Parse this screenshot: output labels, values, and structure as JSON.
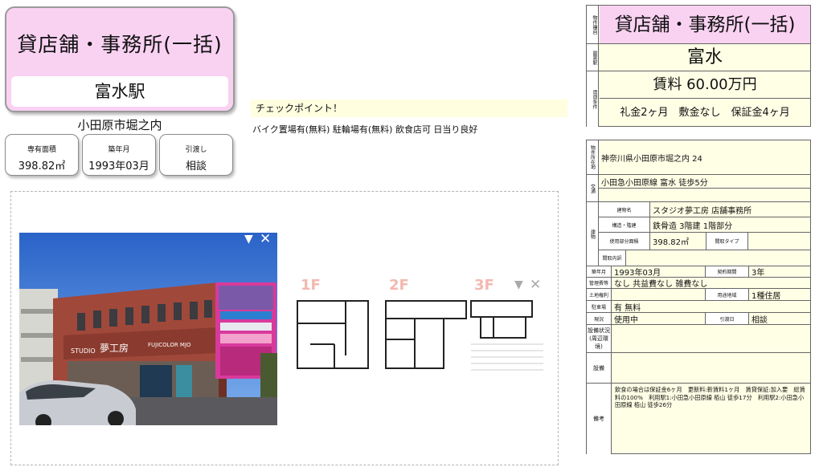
{
  "title_card": {
    "property_type": "貸店舗・事務所(一括)",
    "station": "富水駅"
  },
  "address_short": "小田原市堀之内",
  "stats": [
    {
      "label": "専有面積",
      "value": "398.82㎡"
    },
    {
      "label": "築年月",
      "value": "1993年03月"
    },
    {
      "label": "引渡し",
      "value": "相談"
    }
  ],
  "check_point": {
    "title": "チェックポイント！",
    "text": "バイク置場有(無料) 駐輪場有(無料) 飲食店可 日当り良好"
  },
  "photo": {
    "sign_main": "夢工房",
    "sign_studio": "STUDIO",
    "sign_film": "FUJICOLOR MJO"
  },
  "floorplan": {
    "floors": [
      "1F",
      "2F",
      "3F"
    ]
  },
  "summary": {
    "type_label": "物件種目",
    "type": "貸店舗・事務所(一括)",
    "station_label": "最寄駅",
    "station": "富水",
    "rent_label": "賃貸条件",
    "rent": "賃料 60.00万円",
    "conditions": "礼金2ヶ月　敷金なし　保証金4ヶ月"
  },
  "detail": {
    "address_label": "物件所在地",
    "address": "神奈川県小田原市堀之内 24",
    "traffic_label": "交通",
    "traffic": "小田急小田原線 富水 徒歩5分",
    "building_label": "建物",
    "building_name_label": "建物名",
    "building_name": "スタジオ夢工房 店舗事務所",
    "structure_label": "構造・階建",
    "structure": "鉄骨造 3階建 1階部分",
    "area_label": "使用部分面積",
    "area": "398.82㎡",
    "layout_type_label": "間取タイプ",
    "layout_detail_label": "間取内訳",
    "built_label": "築年月",
    "built": "1993年03月",
    "contract_label": "契約期間",
    "contract": "3年",
    "fee_label": "管理費等",
    "fee": "なし 共益費なし 雑費なし",
    "land_label": "土地権利",
    "zoning_label": "用途地域",
    "zoning": "1種住居",
    "parking_label": "駐車場",
    "parking": "有 無料",
    "status_label": "現況",
    "status": "使用中",
    "handover_label": "引渡日",
    "handover": "相談",
    "facilities_label": "設備状況(周辺環境)",
    "equipment_label": "設備",
    "remarks_label": "備考",
    "remarks": "飲食の場合は保証金6ヶ月　更新料:新賃料1ヶ月　賃貸保証:加入要　総賃料の100%　利用駅1:小田急小田原線 栢山 徒歩17分　利用駅2:小田急小田原線 栢山 徒歩26分"
  },
  "colors": {
    "title_bg": "#f9d2f2",
    "table_bg": "#ffffe6",
    "check_bg": "#ffffe0"
  }
}
